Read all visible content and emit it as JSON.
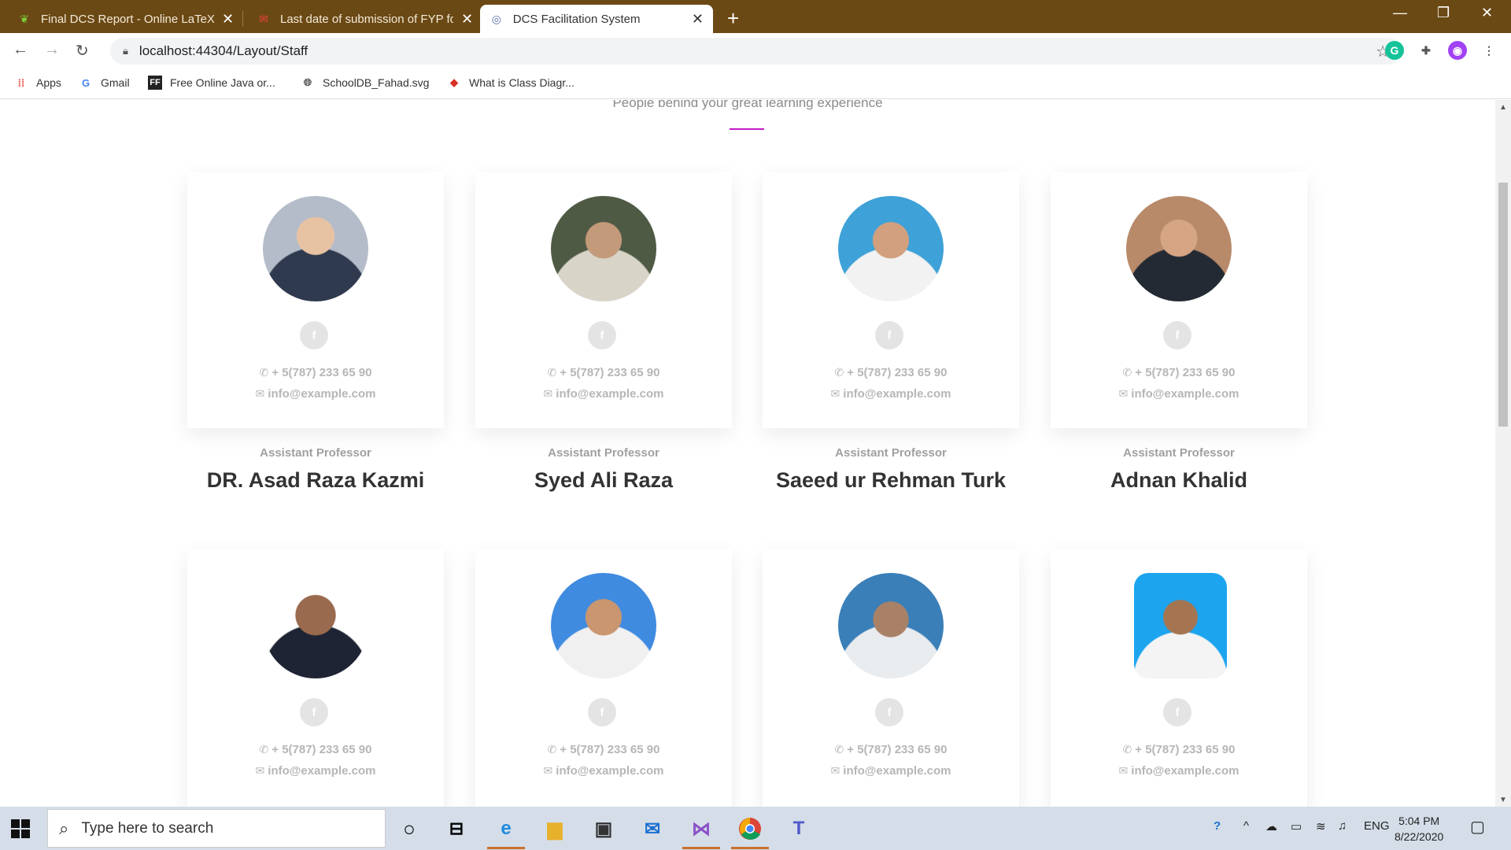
{
  "browser": {
    "tabs": [
      {
        "title": "Final DCS Report - Online LaTeX Ed",
        "favicon": "overleaf-icon",
        "active": false
      },
      {
        "title": "Last date of submission of FYP fo",
        "favicon": "gmail-icon",
        "active": false
      },
      {
        "title": "DCS Facilitation System",
        "favicon": "site-icon",
        "active": true
      }
    ],
    "tab_close": "✕",
    "new_tab": "+",
    "url": "localhost:44304/Layout/Staff",
    "bookmarks": [
      {
        "label": "Apps",
        "icon": "apps-grid-icon"
      },
      {
        "label": "Gmail",
        "icon": "google-icon"
      },
      {
        "label": "Free Online Java or...",
        "icon": "ff-icon"
      },
      {
        "label": "SchoolDB_Fahad.svg",
        "icon": "globe-icon"
      },
      {
        "label": "What is Class Diagr...",
        "icon": "diamond-icon"
      }
    ]
  },
  "page": {
    "subtitle": "People behind your great learning experience",
    "accent_color": "#c21cc5",
    "staff": [
      {
        "role": "Assistant Professor",
        "name": "DR. Asad Raza Kazmi",
        "phone": "+ 5(787) 233 65 90",
        "email": "info@example.com",
        "fb": "f"
      },
      {
        "role": "Assistant Professor",
        "name": "Syed Ali Raza",
        "phone": "+ 5(787) 233 65 90",
        "email": "info@example.com",
        "fb": "f"
      },
      {
        "role": "Assistant Professor",
        "name": "Saeed ur Rehman Turk",
        "phone": "+ 5(787) 233 65 90",
        "email": "info@example.com",
        "fb": "f"
      },
      {
        "role": "Assistant Professor",
        "name": "Adnan Khalid",
        "phone": "+ 5(787) 233 65 90",
        "email": "info@example.com",
        "fb": "f"
      },
      {
        "phone": "+ 5(787) 233 65 90",
        "email": "info@example.com",
        "fb": "f"
      },
      {
        "phone": "+ 5(787) 233 65 90",
        "email": "info@example.com",
        "fb": "f"
      },
      {
        "phone": "+ 5(787) 233 65 90",
        "email": "info@example.com",
        "fb": "f"
      },
      {
        "phone": "+ 5(787) 233 65 90",
        "email": "info@example.com",
        "fb": "f"
      }
    ]
  },
  "taskbar": {
    "search_placeholder": "Type here to search",
    "language": "ENG",
    "time": "5:04 PM",
    "date": "8/22/2020"
  }
}
